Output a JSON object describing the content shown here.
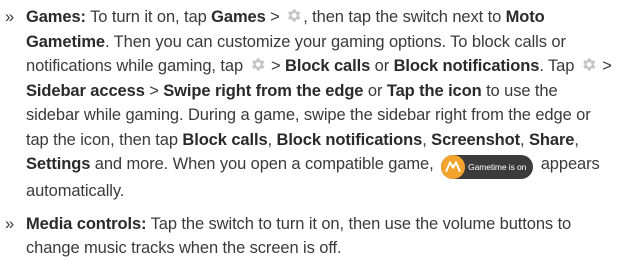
{
  "list": {
    "bullet": "»",
    "games": {
      "lead": "Games:",
      "t1": " To turn it on, tap ",
      "games_label": "Games",
      "t2": " > ",
      "t3": ", then tap the switch next to ",
      "moto_gametime": "Moto Gametime",
      "t4": ". Then you can customize your gaming options. To block calls or notifications while gaming, tap ",
      "t5": " > ",
      "block_calls": "Block calls",
      "t6": " or ",
      "block_notifications": "Block notifications",
      "t7": ". Tap ",
      "t8": " > ",
      "sidebar_access": "Sidebar access",
      "t9": " > ",
      "swipe_right": "Swipe right from the edge",
      "t10": " or ",
      "tap_icon": "Tap the icon",
      "t11": " to use the sidebar while gaming. During a game, swipe the sidebar right from the edge or tap the icon, then tap ",
      "block_calls_2": "Block calls",
      "t12": ", ",
      "block_notifications_2": "Block notifications",
      "t13": ", ",
      "screenshot": "Screenshot",
      "t14": ", ",
      "share": "Share",
      "t15": ", ",
      "settings": "Settings",
      "t16": " and more. When you open a compatible game, ",
      "t17": " appears automatically."
    },
    "media": {
      "lead": "Media controls:",
      "t1": " Tap the switch to turn it on, then use the volume buttons to change music tracks when the screen is off."
    }
  },
  "badge": {
    "label": "Gametime is on"
  },
  "icons": {
    "gear": "gear-icon",
    "logo": "motorola-logo-icon"
  },
  "colors": {
    "text": "#3a3a3a",
    "gear": "#c4c4c4",
    "badge_bg": "#3b3b3b",
    "logo_bg": "#f2a32b"
  }
}
